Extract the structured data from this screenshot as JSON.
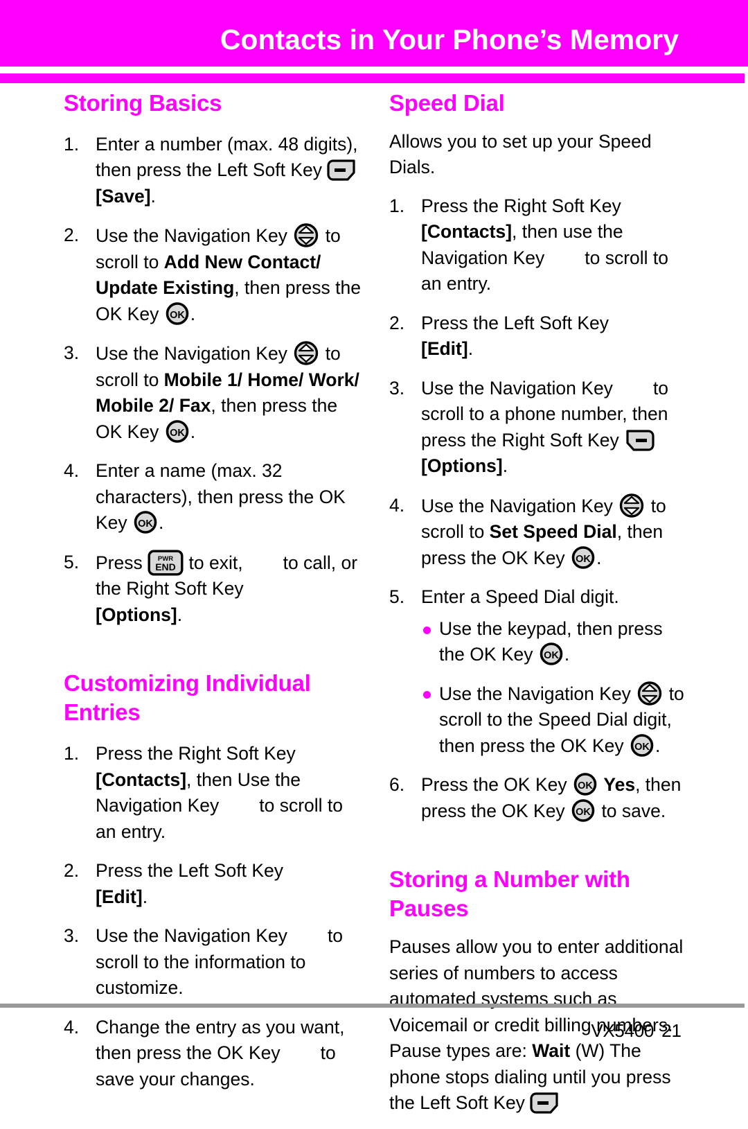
{
  "header": {
    "title": "Contacts in Your Phone’s Memory",
    "bar_color": "#ff00ff",
    "title_color": "#ffffff"
  },
  "colors": {
    "accent": "#ff00ff",
    "text": "#000000",
    "footer_rule": "#9a9a9a",
    "key_fill": "#d9d9d9"
  },
  "icons": {
    "left_soft_key": "left-soft-key-icon",
    "right_soft_key": "right-soft-key-icon",
    "navigation_key": "navigation-key-icon",
    "ok_key": "ok-key-icon",
    "end_key": "pwr-end-key-icon",
    "ok_label": "OK",
    "end_label_top": "PWR",
    "end_label_bottom": "END"
  },
  "left_column": {
    "storing_basics": {
      "heading": "Storing Basics",
      "steps": [
        {
          "num": "1.",
          "p1": "Enter a number (max. 48 digits), then press the Left Soft Key",
          "p2": "",
          "bold1": "[Save]",
          "p3": "."
        },
        {
          "num": "2.",
          "p1": "Use the Navigation Key",
          "p2": "to scroll to ",
          "bold1": "Add New Contact/ Update Existing",
          "p3": ", then press the OK Key",
          "p4": "."
        },
        {
          "num": "3.",
          "p1": "Use the Navigation Key",
          "p2": "to scroll to ",
          "bold1": "Mobile 1/ Home/ Work/ Mobile 2/ Fax",
          "p3": ", then press the OK Key",
          "p4": "."
        },
        {
          "num": "4.",
          "p1": "Enter a name (max. 32 characters), then press the OK Key",
          "p2": "."
        },
        {
          "num": "5.",
          "p1": "Press",
          "p2": "to exit,",
          "p3": "to call, or the Right Soft Key",
          "bold1": "[Options]",
          "p4": "."
        }
      ]
    },
    "customizing_entries": {
      "heading": "Customizing Individual Entries",
      "steps": [
        {
          "num": "1.",
          "p1": "Press the Right Soft Key",
          "bold1": "[Contacts]",
          "p2": ", then Use the Navigation Key",
          "p3": "to scroll to an entry."
        },
        {
          "num": "2.",
          "p1": "Press the Left Soft Key",
          "bold1": "[Edit]",
          "p2": "."
        },
        {
          "num": "3.",
          "p1": "Use the Navigation Key",
          "p2": "to scroll to the information to customize."
        },
        {
          "num": "4.",
          "p1": "Change the entry as you want, then press the OK Key",
          "p2": "to save your changes."
        }
      ]
    }
  },
  "right_column": {
    "speed_dial": {
      "heading": "Speed Dial",
      "intro": "Allows you to set up your Speed Dials.",
      "steps": [
        {
          "num": "1.",
          "p1": "Press the Right Soft Key",
          "bold1": "[Contacts]",
          "p2": ", then use the Navigation Key",
          "p3": "to scroll to an entry."
        },
        {
          "num": "2.",
          "p1": "Press the Left Soft Key",
          "bold1": "[Edit]",
          "p2": "."
        },
        {
          "num": "3.",
          "p1": "Use the Navigation Key",
          "p2": "to scroll to a phone number, then press the Right Soft Key",
          "bold1": "[Options]",
          "p3": "."
        },
        {
          "num": "4.",
          "p1": "Use the Navigation Key",
          "p2": "to scroll to ",
          "bold1": "Set Speed Dial",
          "p3": ", then press the OK Key",
          "p4": "."
        },
        {
          "num": "5.",
          "p1": "Enter a Speed Dial digit.",
          "bullets": [
            {
              "p1": "Use the keypad, then press the OK Key",
              "p2": "."
            },
            {
              "p1": "Use the Navigation Key",
              "p2": "to scroll to the Speed Dial digit, then press the OK Key",
              "p3": "."
            }
          ]
        },
        {
          "num": "6.",
          "p1": "Press the OK Key",
          "bold1": "Yes",
          "p2": ", then press the OK Key",
          "p3": "to save."
        }
      ]
    },
    "storing_pauses": {
      "heading": "Storing a Number with Pauses",
      "body_1": "Pauses allow you to enter additional series of numbers to access automated systems such as Voicemail or credit billing numbers. Pause types are: ",
      "body_bold": "Wait",
      "body_2": " (W) The phone stops dialing until you press the Left Soft Key"
    }
  },
  "footer": {
    "model": "VX5400",
    "page": "21"
  }
}
